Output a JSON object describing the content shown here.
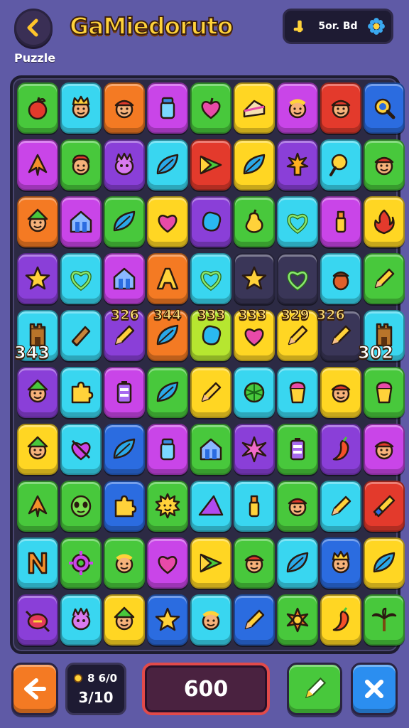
{
  "header": {
    "title": "GaMiedoruto",
    "mode_label": "Puzzle",
    "score_text": "5or. Bd"
  },
  "colors": {
    "background": "#5f5aa6",
    "board": "#2c2a44",
    "title": "#ffd23a",
    "tile_green": "#48c83c",
    "tile_cyan": "#39d6f0",
    "tile_orange": "#f47a23",
    "tile_magenta": "#c945e8",
    "tile_red": "#e33a2c",
    "tile_yellow": "#ffd623",
    "tile_blue": "#2b6ce0",
    "tile_purple": "#8a3fd8"
  },
  "board": {
    "combos": [
      "343",
      "326",
      "344",
      "333",
      "333",
      "329",
      "326",
      "302"
    ],
    "rows": [
      [
        {
          "c": "green",
          "i": "apple-icon"
        },
        {
          "c": "cyan",
          "i": "king-face-icon"
        },
        {
          "c": "orange",
          "i": "hat-face-icon"
        },
        {
          "c": "magenta",
          "i": "jar-icon"
        },
        {
          "c": "green",
          "i": "heart-fruit-icon"
        },
        {
          "c": "yellow",
          "i": "cake-icon"
        },
        {
          "c": "magenta",
          "i": "smile-face-icon"
        },
        {
          "c": "red",
          "i": "hat-face-icon"
        },
        {
          "c": "blue",
          "i": "magnifier-icon"
        }
      ],
      [
        {
          "c": "magenta",
          "i": "arrow-up-icon"
        },
        {
          "c": "green",
          "i": "redhair-face-icon"
        },
        {
          "c": "purple",
          "i": "monster-icon"
        },
        {
          "c": "cyan",
          "i": "leaf-icon"
        },
        {
          "c": "red",
          "i": "triangle-flag-icon"
        },
        {
          "c": "yellow",
          "i": "leaf-icon"
        },
        {
          "c": "purple",
          "i": "sparkle-bulb-icon"
        },
        {
          "c": "cyan",
          "i": "pin-icon"
        },
        {
          "c": "green",
          "i": "hat-face-icon"
        }
      ],
      [
        {
          "c": "orange",
          "i": "elf-face-icon"
        },
        {
          "c": "magenta",
          "i": "house-icon"
        },
        {
          "c": "green",
          "i": "leaf-icon"
        },
        {
          "c": "yellow",
          "i": "heart-icon"
        },
        {
          "c": "purple",
          "i": "blob-icon"
        },
        {
          "c": "green",
          "i": "pear-icon"
        },
        {
          "c": "cyan",
          "i": "heart-outline-icon"
        },
        {
          "c": "magenta",
          "i": "bottle-icon"
        },
        {
          "c": "yellow",
          "i": "fire-icon"
        }
      ],
      [
        {
          "c": "purple",
          "i": "star-icon"
        },
        {
          "c": "cyan",
          "i": "heart-outline-icon"
        },
        {
          "c": "magenta",
          "i": "house-icon"
        },
        {
          "c": "orange",
          "i": "letter-a-icon"
        },
        {
          "c": "cyan",
          "i": "heart-outline-icon"
        },
        {
          "c": "dark",
          "i": "star-icon"
        },
        {
          "c": "dark",
          "i": "heart-outline-icon"
        },
        {
          "c": "cyan",
          "i": "acorn-icon"
        },
        {
          "c": "green",
          "i": "pencil-icon"
        }
      ],
      [
        {
          "c": "cyan",
          "i": "tower-icon"
        },
        {
          "c": "cyan",
          "i": "scroll-icon"
        },
        {
          "c": "purple",
          "i": "pencil-icon"
        },
        {
          "c": "orange",
          "i": "leaf-icon"
        },
        {
          "c": "lime",
          "i": "blob-icon"
        },
        {
          "c": "yellow",
          "i": "heart-icon"
        },
        {
          "c": "yellow",
          "i": "pencil-icon"
        },
        {
          "c": "dark",
          "i": "pencil-icon"
        },
        {
          "c": "cyan",
          "i": "tower-icon"
        }
      ],
      [
        {
          "c": "purple",
          "i": "elf-face-icon"
        },
        {
          "c": "cyan",
          "i": "puzzle-icon"
        },
        {
          "c": "magenta",
          "i": "battery-icon"
        },
        {
          "c": "green",
          "i": "leaf-icon"
        },
        {
          "c": "yellow",
          "i": "pencil-icon"
        },
        {
          "c": "cyan",
          "i": "shell-icon"
        },
        {
          "c": "cyan",
          "i": "cup-icon"
        },
        {
          "c": "yellow",
          "i": "hat-face-icon"
        },
        {
          "c": "green",
          "i": "cup-icon"
        }
      ],
      [
        {
          "c": "yellow",
          "i": "elf-face-icon"
        },
        {
          "c": "cyan",
          "i": "cross-heart-icon"
        },
        {
          "c": "blue",
          "i": "leaf-icon"
        },
        {
          "c": "magenta",
          "i": "jar-icon"
        },
        {
          "c": "green",
          "i": "house-icon"
        },
        {
          "c": "purple",
          "i": "sparkle-icon"
        },
        {
          "c": "green",
          "i": "battery-icon"
        },
        {
          "c": "purple",
          "i": "pepper-icon"
        },
        {
          "c": "magenta",
          "i": "hat-face-icon"
        }
      ],
      [
        {
          "c": "green",
          "i": "arrow-up-icon"
        },
        {
          "c": "green",
          "i": "alien-icon"
        },
        {
          "c": "blue",
          "i": "puzzle-icon"
        },
        {
          "c": "green",
          "i": "sun-face-icon"
        },
        {
          "c": "cyan",
          "i": "triangle-icon"
        },
        {
          "c": "cyan",
          "i": "bottle-icon"
        },
        {
          "c": "green",
          "i": "hat-face-icon"
        },
        {
          "c": "cyan",
          "i": "pencil-icon"
        },
        {
          "c": "red",
          "i": "rocket-icon"
        }
      ],
      [
        {
          "c": "cyan",
          "i": "letter-n-icon"
        },
        {
          "c": "green",
          "i": "gear-icon"
        },
        {
          "c": "green",
          "i": "smile-face-icon"
        },
        {
          "c": "magenta",
          "i": "heart-icon"
        },
        {
          "c": "yellow",
          "i": "triangle-flag-icon"
        },
        {
          "c": "green",
          "i": "hat-face-icon"
        },
        {
          "c": "cyan",
          "i": "leaf-icon"
        },
        {
          "c": "blue",
          "i": "king-face-icon"
        },
        {
          "c": "yellow",
          "i": "leaf-icon"
        }
      ],
      [
        {
          "c": "purple",
          "i": "candy-icon"
        },
        {
          "c": "cyan",
          "i": "monster-icon"
        },
        {
          "c": "yellow",
          "i": "elf-face-icon"
        },
        {
          "c": "blue",
          "i": "star-icon"
        },
        {
          "c": "cyan",
          "i": "smile-face-icon"
        },
        {
          "c": "blue",
          "i": "pencil-icon"
        },
        {
          "c": "green",
          "i": "sparkle-face-icon"
        },
        {
          "c": "yellow",
          "i": "pepper-icon"
        },
        {
          "c": "green",
          "i": "palm-icon"
        }
      ]
    ]
  },
  "footer": {
    "moves_top": "8 6/0",
    "moves_bottom": "3/10",
    "total": "600"
  }
}
